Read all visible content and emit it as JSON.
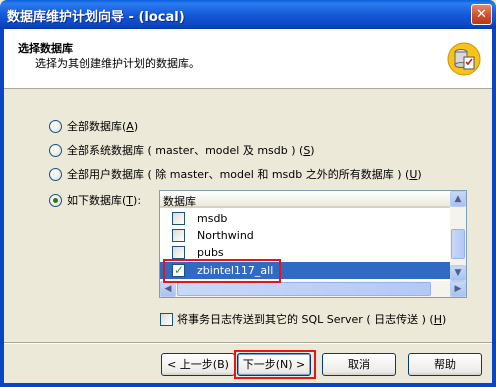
{
  "window": {
    "title": "数据库维护计划向导 - (local)",
    "close_glyph": "✕"
  },
  "header": {
    "title": "选择数据库",
    "subtitle": "选择为其创建维护计划的数据库。",
    "icon": "database-checklist-icon"
  },
  "options": [
    {
      "label": "全部数据库(",
      "key": "A",
      "tail": ")",
      "selected": false
    },
    {
      "label": "全部系统数据库 ( master、model 及 msdb ) (",
      "key": "S",
      "tail": ")",
      "selected": false
    },
    {
      "label": "全部用户数据库 ( 除 master、model 和 msdb 之外的所有数据库 ) (",
      "key": "U",
      "tail": ")",
      "selected": false
    },
    {
      "label": "如下数据库(",
      "key": "T",
      "tail": "):",
      "selected": true
    }
  ],
  "database_list": {
    "column_header": "数据库",
    "rows": [
      {
        "name": "msdb",
        "checked": false,
        "selected": false
      },
      {
        "name": "Northwind",
        "checked": false,
        "selected": false
      },
      {
        "name": "pubs",
        "checked": false,
        "selected": false
      },
      {
        "name": "zbintel117_all",
        "checked": true,
        "selected": true
      }
    ]
  },
  "log_shipping": {
    "label": "将事务日志传送到其它的 SQL Server ( 日志传送 ) (",
    "key": "H",
    "tail": ")",
    "checked": false
  },
  "buttons": {
    "back": "< 上一步(B)",
    "next": "下一步(N) >",
    "cancel": "取消",
    "help": "帮助"
  },
  "colors": {
    "titlebar": "#0a46c3",
    "selection": "#316ac5",
    "highlight_box": "#e01818"
  }
}
